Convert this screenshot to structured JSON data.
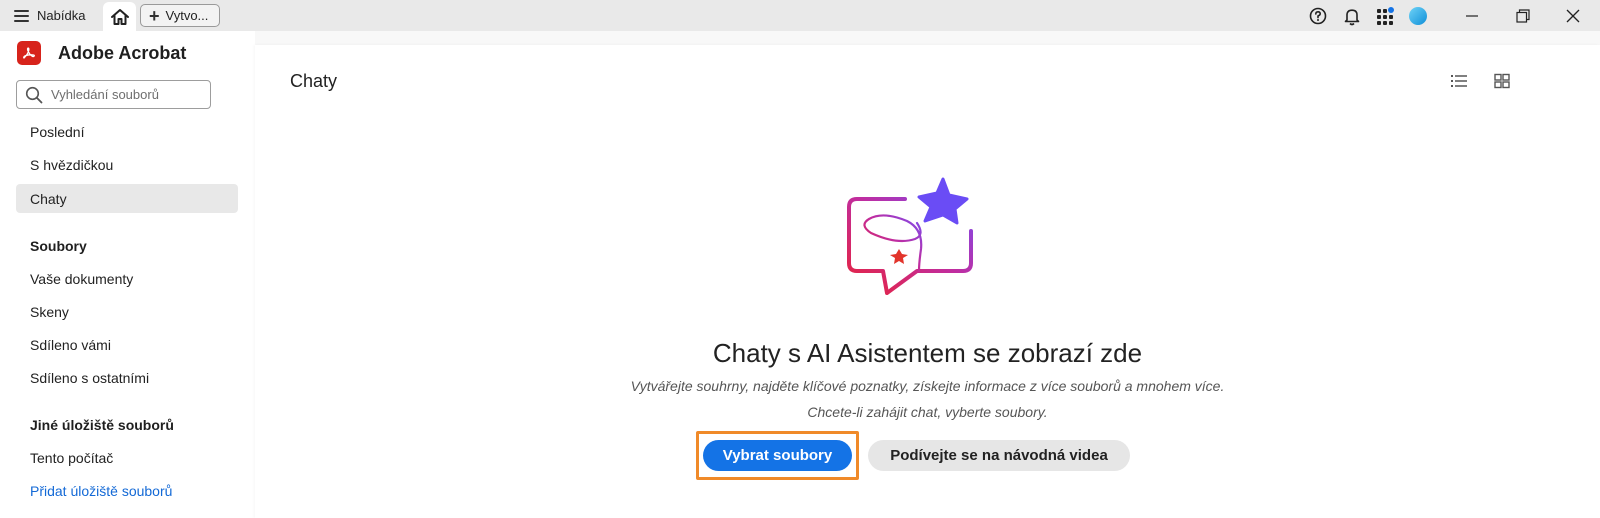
{
  "titlebar": {
    "menu_label": "Nabídka",
    "create_label": "Vytvo...",
    "icons": [
      "menu-icon",
      "home-icon",
      "plus-icon",
      "help-icon",
      "bell-icon",
      "apps-icon",
      "avatar",
      "minimize-icon",
      "restore-icon",
      "close-icon"
    ]
  },
  "sidebar": {
    "app_name": "Adobe Acrobat",
    "search_placeholder": "Vyhledání souborů",
    "recent": "Poslední",
    "starred": "S hvězdičkou",
    "chats": "Chaty",
    "files_heading": "Soubory",
    "your_documents": "Vaše dokumenty",
    "scans": "Skeny",
    "shared_by_you": "Sdíleno vámi",
    "shared_by_others": "Sdíleno s ostatními",
    "other_storage_heading": "Jiné úložiště souborů",
    "this_computer": "Tento počítač",
    "add_storage": "Přidat úložiště souborů"
  },
  "main": {
    "title": "Chaty",
    "empty_title": "Chaty s AI Asistentem se zobrazí zde",
    "empty_subtitle_1": "Vytvářejte souhrny, najděte klíčové poznatky, získejte informace z více souborů a mnohem více.",
    "empty_subtitle_2": "Chcete-li zahájit chat, vyberte soubory.",
    "primary_button": "Vybrat soubory",
    "secondary_button": "Podívejte se na návodná videa"
  },
  "colors": {
    "accent": "#1473e6",
    "brand_red": "#d7231b",
    "focus_outline": "#f08a29",
    "active_nav_bg": "#e8e8e8"
  }
}
